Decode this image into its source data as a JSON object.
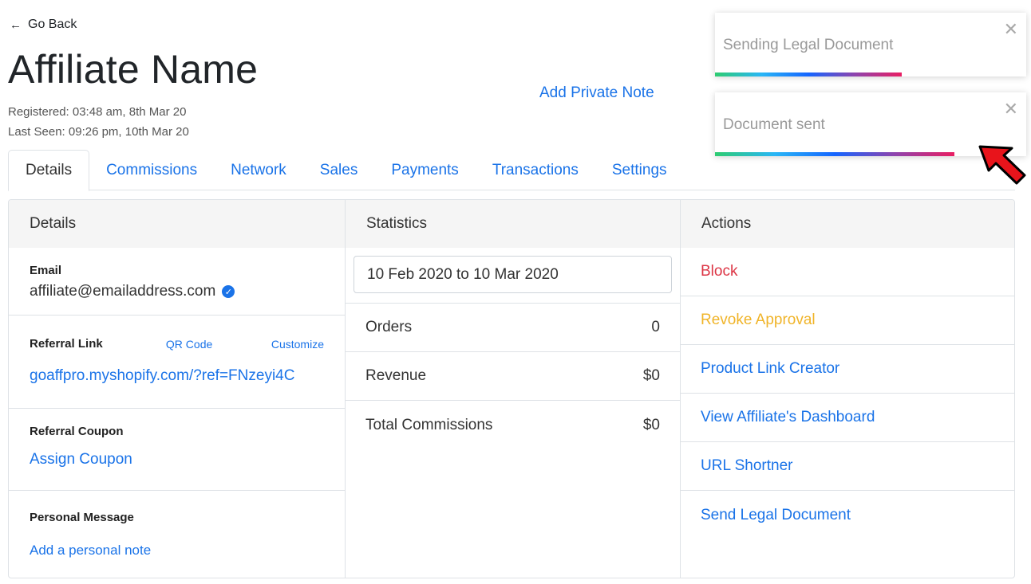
{
  "nav": {
    "back_label": "Go Back",
    "back_icon": "left-arrow-icon"
  },
  "header": {
    "title": "Affiliate Name",
    "registered": "Registered: 03:48 am, 8th Mar 20",
    "last_seen": "Last Seen: 09:26 pm, 10th Mar 20",
    "private_note_label": "Add Private Note"
  },
  "tabs": [
    {
      "label": "Details",
      "active": true
    },
    {
      "label": "Commissions"
    },
    {
      "label": "Network"
    },
    {
      "label": "Sales"
    },
    {
      "label": "Payments"
    },
    {
      "label": "Transactions"
    },
    {
      "label": "Settings"
    }
  ],
  "details": {
    "heading": "Details",
    "email_label": "Email",
    "email_value": "affiliate@emailaddress.com",
    "verified_icon": "check-badge-icon",
    "referral_label": "Referral Link",
    "qr_code_label": "QR Code",
    "customize_label": "Customize",
    "referral_url": "goaffpro.myshopify.com/?ref=FNzeyi4C",
    "coupon_label": "Referral Coupon",
    "assign_coupon_label": "Assign Coupon",
    "message_label": "Personal Message",
    "add_note_label": "Add a personal note"
  },
  "statistics": {
    "heading": "Statistics",
    "date_range": "10 Feb 2020 to 10 Mar 2020",
    "rows": [
      {
        "label": "Orders",
        "value": "0"
      },
      {
        "label": "Revenue",
        "value": "$0"
      },
      {
        "label": "Total Commissions",
        "value": "$0"
      }
    ]
  },
  "actions": {
    "heading": "Actions",
    "items": [
      {
        "label": "Block",
        "color": "#dc3545"
      },
      {
        "label": "Revoke Approval",
        "color": "#f0b429"
      },
      {
        "label": "Product Link Creator",
        "color": "#1a73e8"
      },
      {
        "label": "View Affiliate's Dashboard",
        "color": "#1a73e8"
      },
      {
        "label": "URL Shortner",
        "color": "#1a73e8"
      },
      {
        "label": "Send Legal Document",
        "color": "#1a73e8"
      }
    ]
  },
  "toasts": [
    {
      "text": "Sending Legal Document",
      "progress": 0.6
    },
    {
      "text": "Document sent",
      "progress": 0.77
    }
  ],
  "colors": {
    "link": "#1a73e8",
    "danger": "#dc3545",
    "warning": "#f0b429",
    "pointer_arrow": "#e8141b"
  }
}
